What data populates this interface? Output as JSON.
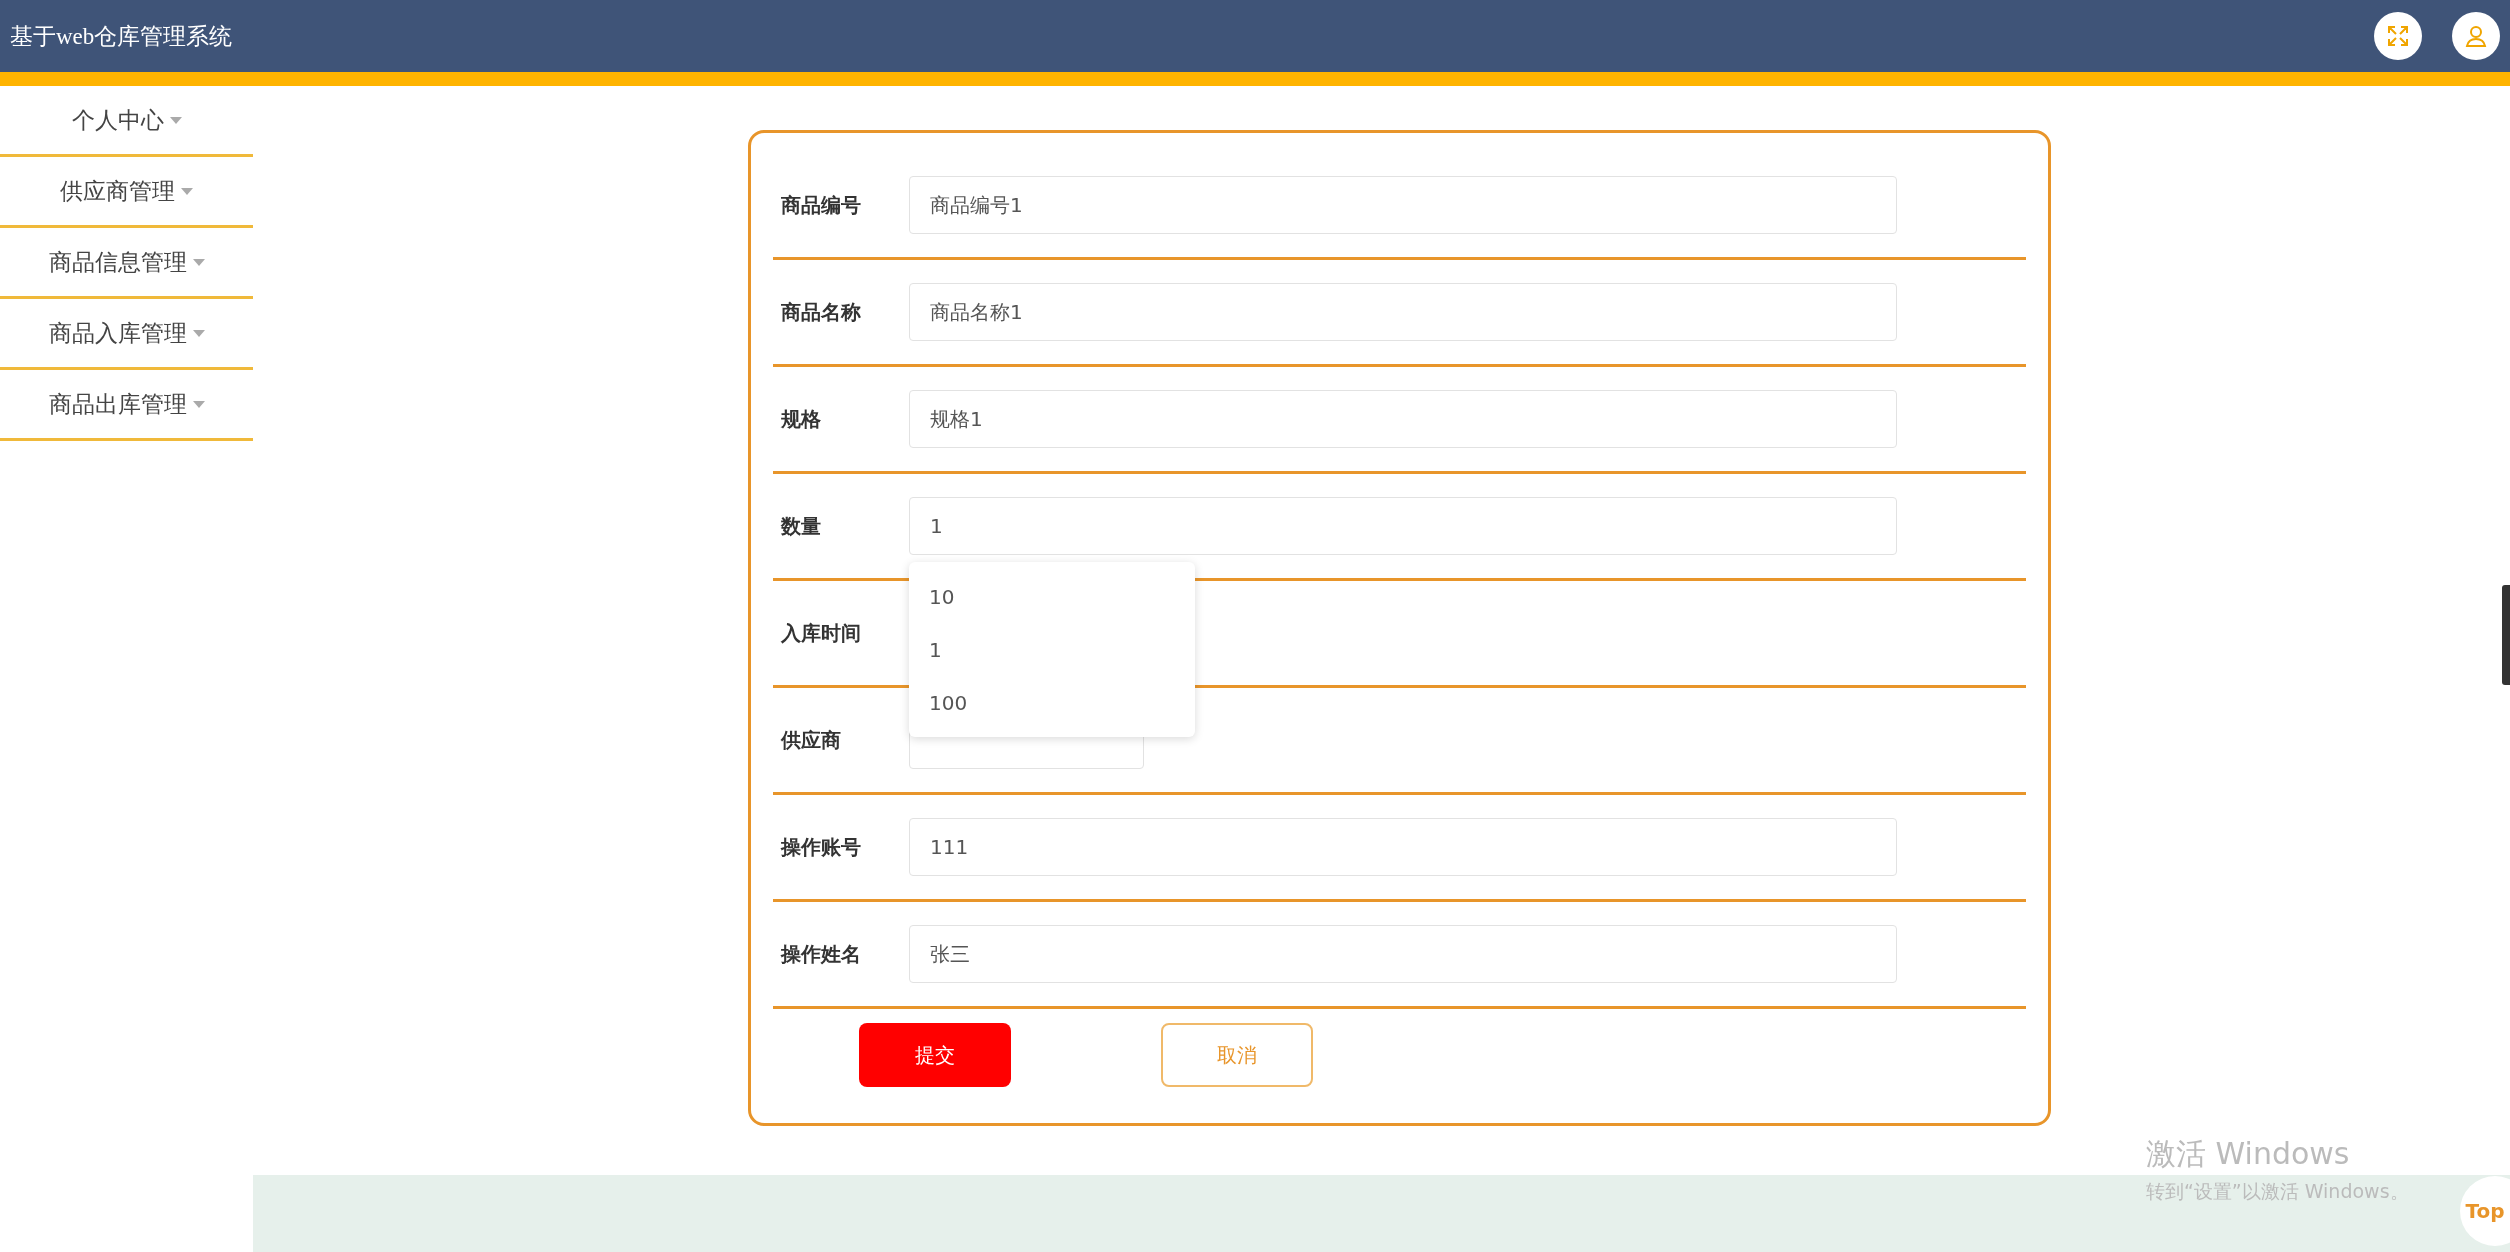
{
  "header": {
    "title": "基于web仓库管理系统"
  },
  "sidebar": {
    "items": [
      {
        "label": "个人中心"
      },
      {
        "label": "供应商管理"
      },
      {
        "label": "商品信息管理"
      },
      {
        "label": "商品入库管理"
      },
      {
        "label": "商品出库管理"
      }
    ]
  },
  "form": {
    "fields": [
      {
        "label": "商品编号",
        "kind": "text",
        "value": "商品编号1"
      },
      {
        "label": "商品名称",
        "kind": "text",
        "value": "商品名称1"
      },
      {
        "label": "规格",
        "kind": "text",
        "value": "规格1"
      },
      {
        "label": "数量",
        "kind": "text",
        "value": "1",
        "suggestions": [
          "10",
          "1",
          "100"
        ]
      },
      {
        "label": "入库时间",
        "kind": "date"
      },
      {
        "label": "供应商",
        "kind": "select"
      },
      {
        "label": "操作账号",
        "kind": "text",
        "value": "111"
      },
      {
        "label": "操作姓名",
        "kind": "text",
        "value": "张三"
      }
    ],
    "buttons": [
      {
        "label": "提交",
        "kind": "primary"
      },
      {
        "label": "取消",
        "kind": "secondary"
      }
    ]
  },
  "back_to_top": "Top",
  "activation_notice": {
    "title": "激活 Windows",
    "subtitle": "转到“设置”以激活 Windows。"
  }
}
